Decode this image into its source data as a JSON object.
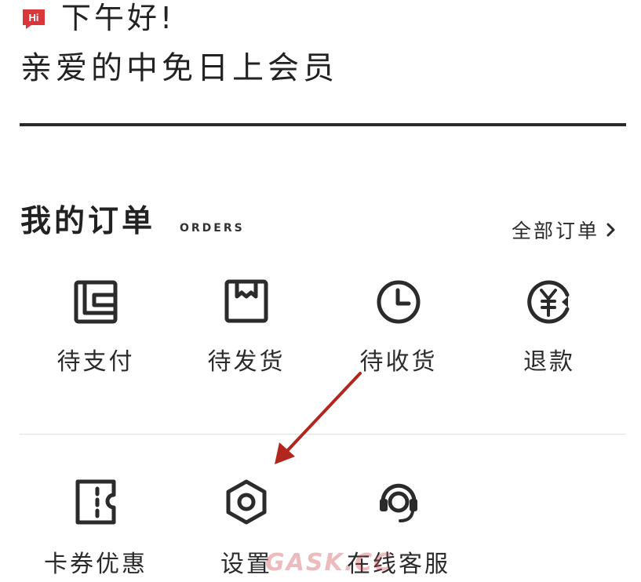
{
  "header": {
    "logo_text": "Hi",
    "greeting": "下午好!",
    "member_text": "亲爱的中免日上会员"
  },
  "orders": {
    "title": "我的订单",
    "subtitle": "ORDERS",
    "all_orders_label": "全部订单",
    "items": [
      {
        "label": "待支付",
        "icon": "wallet-icon"
      },
      {
        "label": "待发货",
        "icon": "box-icon"
      },
      {
        "label": "待收货",
        "icon": "clock-icon"
      },
      {
        "label": "退款",
        "icon": "yen-refund-icon"
      }
    ]
  },
  "services": {
    "items": [
      {
        "label": "卡券优惠",
        "icon": "coupon-icon"
      },
      {
        "label": "设置",
        "icon": "hex-settings-icon"
      },
      {
        "label": "在线客服",
        "icon": "headset-icon"
      }
    ]
  },
  "watermark": "GASK.CC",
  "colors": {
    "brand": "#d9373a",
    "text": "#222222",
    "divider": "#2b2b2b",
    "annotation": "#b3261e"
  }
}
